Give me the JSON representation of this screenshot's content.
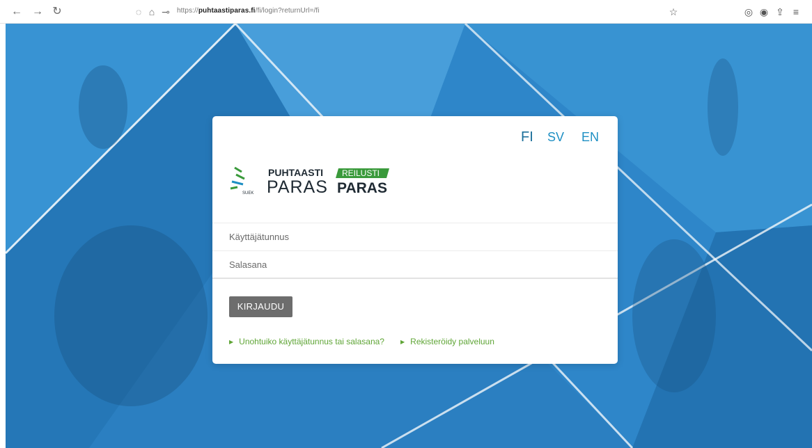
{
  "browser": {
    "back_icon": "back-arrow-icon",
    "forward_icon": "forward-arrow-icon",
    "reload_icon": "reload-icon",
    "url_prefix": "https://",
    "url_domain": "puhtaastiparas.fi",
    "url_path": "/fi/login?returnUrl=/fi"
  },
  "languages": [
    {
      "code": "FI",
      "active": true
    },
    {
      "code": "SV",
      "active": false
    },
    {
      "code": "EN",
      "active": false
    }
  ],
  "logo": {
    "org": "SUEK",
    "brand_line1": "PUHTAASTI",
    "brand_line2": "PARAS",
    "sub_badge": "REILUSTI",
    "sub_line2": "PARAS"
  },
  "form": {
    "username_placeholder": "Käyttäjätunnus",
    "password_placeholder": "Salasana",
    "login_label": "KIRJAUDU"
  },
  "links": {
    "forgot": "Unohtuiko käyttäjätunnus tai salasana?",
    "register": "Rekisteröidy palveluun"
  },
  "colors": {
    "background": "#2b7fc2",
    "language_link": "#1e8fc3",
    "link_green": "#5fa536",
    "button": "#6d6d6d",
    "brand_green": "#3a9a3b",
    "brand_dark": "#1f2a33"
  }
}
